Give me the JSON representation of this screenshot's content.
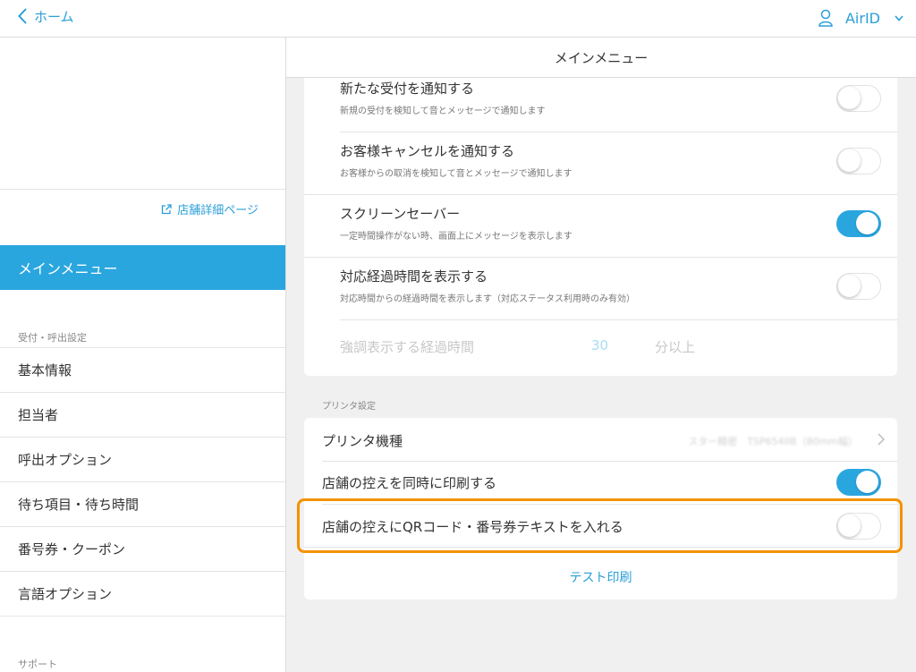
{
  "topbar": {
    "back_label": "ホーム",
    "account_label": "AirID"
  },
  "sidebar": {
    "store_link": "店舗詳細ページ",
    "active_item": "メインメニュー",
    "section_reception": "受付・呼出設定",
    "items": [
      {
        "label": "基本情報"
      },
      {
        "label": "担当者"
      },
      {
        "label": "呼出オプション"
      },
      {
        "label": "待ち項目・待ち時間"
      },
      {
        "label": "番号券・クーポン"
      },
      {
        "label": "言語オプション"
      }
    ],
    "section_support": "サポート"
  },
  "panel": {
    "title": "メインメニュー"
  },
  "settings": {
    "notify_new": {
      "title": "新たな受付を通知する",
      "sub": "新規の受付を検知して音とメッセージで通知します",
      "on": false
    },
    "notify_cancel": {
      "title": "お客様キャンセルを通知する",
      "sub": "お客様からの取消を検知して音とメッセージで通知します",
      "on": false
    },
    "screensaver": {
      "title": "スクリーンセーバー",
      "sub": "一定時間操作がない時、画面上にメッセージを表示します",
      "on": true
    },
    "elapsed": {
      "title": "対応経過時間を表示する",
      "sub": "対応時間からの経過時間を表示します（対応ステータス利用時のみ有効）",
      "on": false
    },
    "highlight_elapsed": {
      "label": "強調表示する経過時間",
      "value": "30",
      "unit": "分以上"
    }
  },
  "printer": {
    "section_label": "プリンタ設定",
    "model_label": "プリンタ機種",
    "model_value": "スター精密　TSP654IIB（80mm幅）",
    "print_copy": {
      "title": "店舗の控えを同時に印刷する",
      "on": true
    },
    "qr_copy": {
      "title": "店舗の控えにQRコード・番号券テキストを入れる",
      "on": false
    },
    "test_print": "テスト印刷"
  },
  "colors": {
    "accent": "#2aa6df",
    "highlight": "#f39200"
  }
}
